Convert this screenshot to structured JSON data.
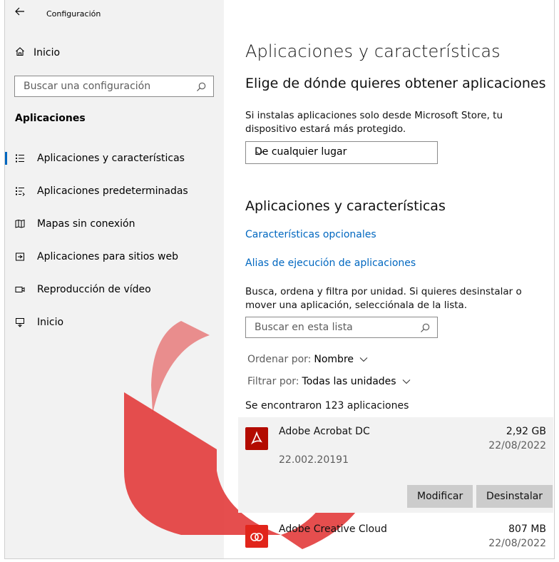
{
  "window": {
    "title": "Configuración",
    "back_icon": "back-arrow-icon"
  },
  "sidebar": {
    "home_label": "Inicio",
    "search_placeholder": "Buscar una configuración",
    "section_title": "Aplicaciones",
    "items": [
      {
        "label": "Aplicaciones y características",
        "icon": "apps-features-icon",
        "active": true
      },
      {
        "label": "Aplicaciones predeterminadas",
        "icon": "default-apps-icon",
        "active": false
      },
      {
        "label": "Mapas sin conexión",
        "icon": "offline-maps-icon",
        "active": false
      },
      {
        "label": "Aplicaciones para sitios web",
        "icon": "apps-websites-icon",
        "active": false
      },
      {
        "label": "Reproducción de vídeo",
        "icon": "video-playback-icon",
        "active": false
      },
      {
        "label": "Inicio",
        "icon": "startup-icon",
        "active": false
      }
    ]
  },
  "main": {
    "title": "Aplicaciones y características",
    "choose_heading": "Elige de dónde quieres obtener aplicaciones",
    "choose_desc": "Si instalas aplicaciones solo desde Microsoft Store, tu dispositivo estará más protegido.",
    "source_value": "De cualquier lugar",
    "apps_heading": "Aplicaciones y características",
    "link_optional": "Características opcionales",
    "link_alias": "Alias de ejecución de aplicaciones",
    "search_desc": "Busca, ordena y filtra por unidad. Si quieres desinstalar o mover una aplicación, selecciónala de la lista.",
    "list_search_placeholder": "Buscar en esta lista",
    "sort_label": "Ordenar por:",
    "sort_value": "Nombre",
    "filter_label": "Filtrar por:",
    "filter_value": "Todas las unidades",
    "count_text": "Se encontraron 123 aplicaciones",
    "apps": [
      {
        "name": "Adobe Acrobat DC",
        "size": "2,92 GB",
        "date": "22/08/2022",
        "version": "22.002.20191",
        "icon_color": "#b30b00",
        "selected": true
      },
      {
        "name": "Adobe Creative Cloud",
        "size": "807 MB",
        "date": "22/08/2022",
        "version": "",
        "icon_color": "#e1251b",
        "selected": false
      }
    ],
    "modify_label": "Modificar",
    "uninstall_label": "Desinstalar"
  },
  "colors": {
    "accent": "#0067c0",
    "sidebar_bg": "#f2f2f2",
    "watermark": "#e23b3b"
  }
}
